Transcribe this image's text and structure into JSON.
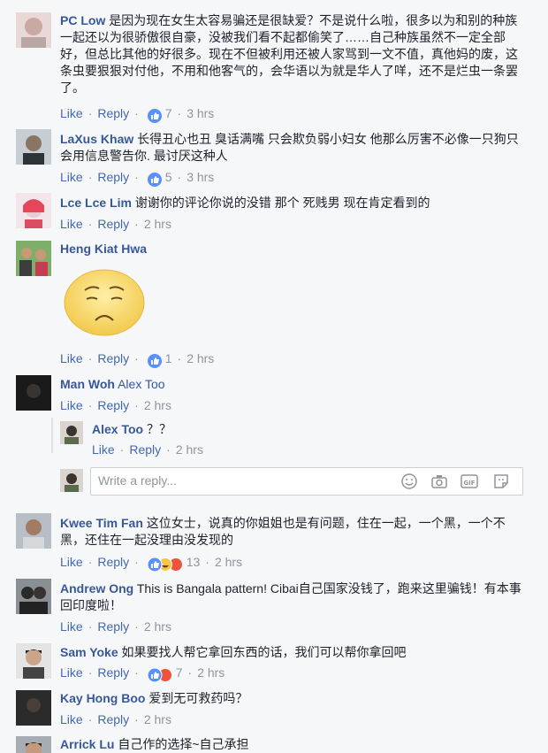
{
  "comments": [
    {
      "name": "PC Low",
      "text": "是因为现在女生太容易骗还是很缺爱？不是说什么啦，很多以为和别的种族一起还以为很骄傲很自豪，没被我们看不起都偷笑了……自己种族虽然不一定全部好，但总比其他的好很多。现在不但被利用还被人家骂到一文不值，真他妈的废，这条虫要狠狠对付他，不用和他客气的，会华语以为就是华人了咩，还不是烂虫一条罢了。",
      "like": "Like",
      "reply": "Reply",
      "count": "7",
      "time": "3 hrs"
    },
    {
      "name": "LaXus Khaw",
      "text": "长得丑心也丑 臭话满嘴 只会欺负弱小妇女 他那么厉害不必像一只狗只会用信息警告你. 最讨厌这种人",
      "like": "Like",
      "reply": "Reply",
      "count": "5",
      "time": "3 hrs"
    },
    {
      "name": "Lce Lce Lim",
      "text": "谢谢你的评论你说的没错 那个 死贱男 现在肯定看到的",
      "like": "Like",
      "reply": "Reply",
      "time": "2 hrs"
    },
    {
      "name": "Heng Kiat Hwa",
      "like": "Like",
      "reply": "Reply",
      "count": "1",
      "time": "2 hrs"
    },
    {
      "name": "Man Woh",
      "mention": "Alex Too",
      "like": "Like",
      "reply": "Reply",
      "time": "2 hrs"
    },
    {
      "name": "Kwee Tim Fan",
      "text": "这位女士，说真的你姐姐也是有问题，住在一起，一个黑，一个不黑，还住在一起没理由没发现的",
      "like": "Like",
      "reply": "Reply",
      "count": "13",
      "time": "2 hrs"
    },
    {
      "name": "Andrew Ong",
      "text": "This is Bangala pattern! Cibai自己国家没钱了，跑来这里骗钱！有本事回印度啦！",
      "like": "Like",
      "reply": "Reply",
      "time": "2 hrs"
    },
    {
      "name": "Sam Yoke",
      "text": "如果要找人帮它拿回东西的话，我们可以帮你拿回吧",
      "like": "Like",
      "reply": "Reply",
      "count": "7",
      "time": "2 hrs"
    },
    {
      "name": "Kay Hong Boo",
      "text": "爱到无可救药吗？",
      "like": "Like",
      "reply": "Reply",
      "time": "2 hrs"
    },
    {
      "name": "Arrick Lu",
      "text": "自己作的选择~自己承担"
    }
  ],
  "reply": {
    "name": "Alex Too",
    "text": "？？",
    "like": "Like",
    "reply": "Reply",
    "time": "2 hrs"
  },
  "reply_box": {
    "placeholder": "Write a reply..."
  },
  "colors": {
    "link": "#365899",
    "action": "#4b4f56",
    "meta": "#90949c",
    "like_blue": "#4267b2",
    "bg": "#f6f7f9"
  }
}
